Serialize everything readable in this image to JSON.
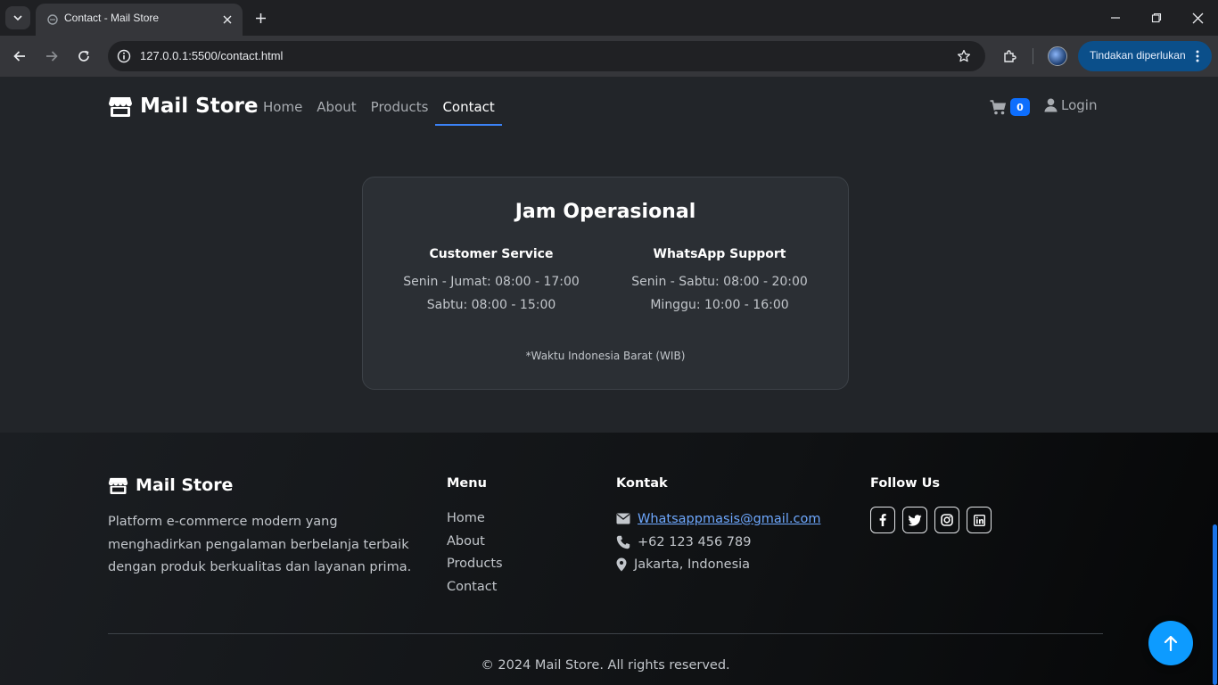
{
  "browser": {
    "tab_title": "Contact - Mail Store",
    "url": "127.0.0.1:5500/contact.html",
    "action_label": "Tindakan diperlukan"
  },
  "navbar": {
    "brand": "Mail Store",
    "links": [
      "Home",
      "About",
      "Products",
      "Contact"
    ],
    "active": "Contact",
    "cart_count": "0",
    "login_label": "Login"
  },
  "hours": {
    "title": "Jam Operasional",
    "columns": [
      {
        "title": "Customer Service",
        "lines": [
          "Senin - Jumat: 08:00 - 17:00",
          "Sabtu: 08:00 - 15:00"
        ]
      },
      {
        "title": "WhatsApp Support",
        "lines": [
          "Senin - Sabtu: 08:00 - 20:00",
          "Minggu: 10:00 - 16:00"
        ]
      }
    ],
    "note": "*Waktu Indonesia Barat (WIB)"
  },
  "footer": {
    "brand": "Mail Store",
    "description": "Platform e-commerce modern yang menghadirkan pengalaman berbelanja terbaik dengan produk berkualitas dan layanan prima.",
    "menu_heading": "Menu",
    "menu": [
      "Home",
      "About",
      "Products",
      "Contact"
    ],
    "contact_heading": "Kontak",
    "email": "Whatsappmasis@gmail.com",
    "phone": "+62 123 456 789",
    "location": "Jakarta, Indonesia",
    "follow_heading": "Follow Us",
    "socials": [
      "facebook-icon",
      "twitter-icon",
      "instagram-icon",
      "linkedin-icon"
    ],
    "copyright": "© 2024 Mail Store. All rights reserved."
  },
  "colors": {
    "accent": "#0d6efd",
    "to_top": "#0d9bff",
    "link": "#6ea8fe"
  }
}
